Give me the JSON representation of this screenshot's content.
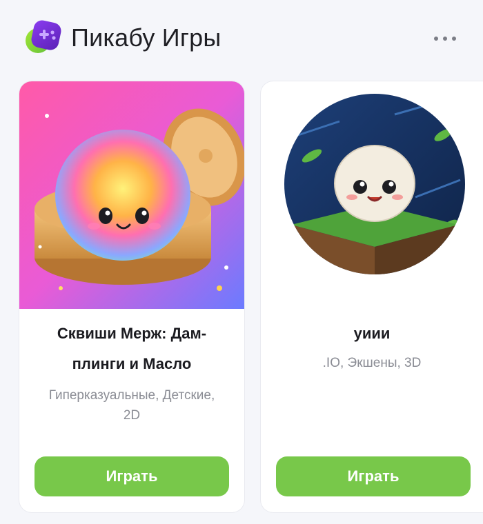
{
  "header": {
    "title": "Пикабу Игры"
  },
  "games": [
    {
      "name": "Сквиши Мерж: Дам-\nплинги и Масло",
      "name_line1": "Сквиши Мерж: Дам-",
      "name_line2": "плинги и Масло",
      "tags_line1": "Гиперказуальные, Детские,",
      "tags_line2": "2D",
      "play_label": "Играть"
    },
    {
      "name": "уиии",
      "tags_line1": ".IO, Экшены, 3D",
      "play_label": "Играть"
    }
  ],
  "colors": {
    "accent": "#78c84a",
    "background": "#f5f6fa",
    "text_primary": "#1b1b20",
    "text_secondary": "#8a8c94"
  },
  "icons": {
    "logo": "pikabu-games-logo",
    "more": "more-horizontal-icon"
  }
}
